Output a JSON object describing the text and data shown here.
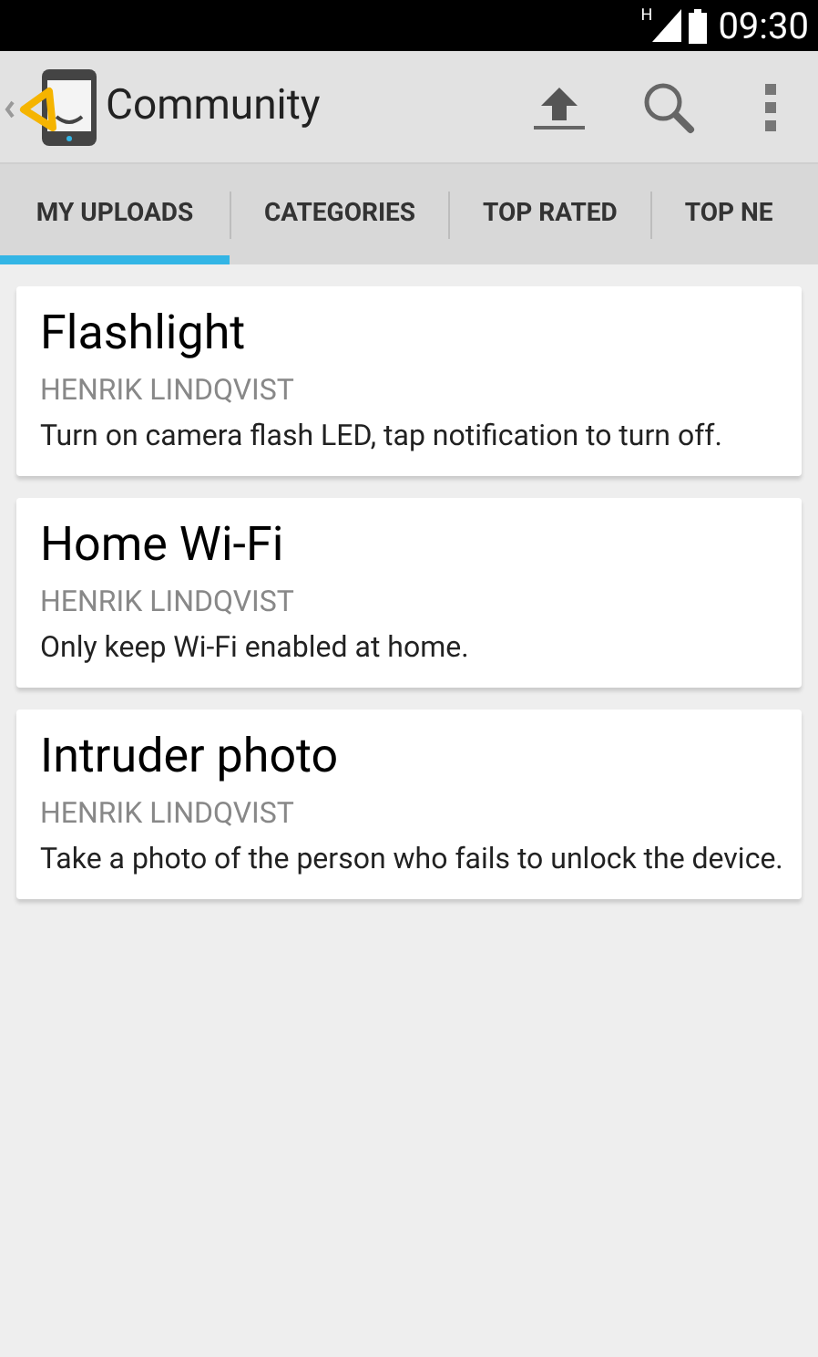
{
  "status_bar": {
    "network": "H",
    "time": "09:30"
  },
  "action_bar": {
    "title": "Community"
  },
  "tabs": [
    {
      "label": "MY UPLOADS",
      "selected": true
    },
    {
      "label": "CATEGORIES",
      "selected": false
    },
    {
      "label": "TOP RATED",
      "selected": false
    },
    {
      "label": "TOP NE",
      "selected": false
    }
  ],
  "items": [
    {
      "title": "Flashlight",
      "author": "HENRIK LINDQVIST",
      "description": "Turn on camera flash LED, tap notification to turn off."
    },
    {
      "title": "Home Wi-Fi",
      "author": "HENRIK LINDQVIST",
      "description": "Only keep Wi-Fi enabled at home."
    },
    {
      "title": "Intruder photo",
      "author": "HENRIK LINDQVIST",
      "description": "Take a photo of the person who fails to unlock the device."
    }
  ]
}
